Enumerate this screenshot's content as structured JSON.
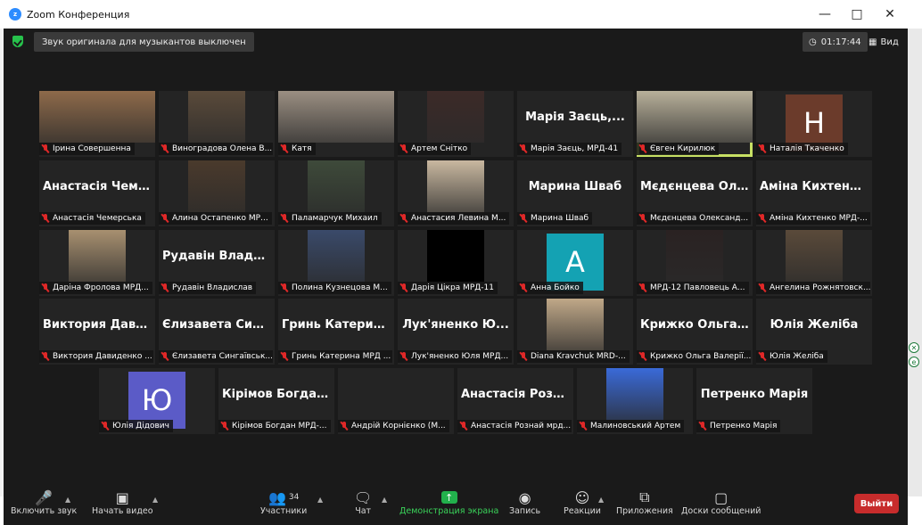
{
  "window": {
    "title": "Zoom Конференция",
    "app_icon": "zoom"
  },
  "top": {
    "notice": "Звук оригинала для музыкантов выключен",
    "timer": "01:17:44",
    "view_label": "Вид"
  },
  "colors": {
    "active_speaker": "#c7e064",
    "muted_mic": "#e02828",
    "leave": "#c72c2c",
    "share": "#22b14c"
  },
  "participants": [
    {
      "label": "Ірина Совершенна",
      "kind": "photo",
      "bg": "#8e6a4a"
    },
    {
      "label": "Виноградова Олена В...",
      "kind": "photo",
      "bg": "#5a4a3a"
    },
    {
      "label": "Катя",
      "kind": "photo",
      "bg": "#9b8f82"
    },
    {
      "label": "Артем Снітко",
      "kind": "photo",
      "bg": "#3c2a28"
    },
    {
      "label": "Марія Заєць, МРД-41",
      "kind": "name",
      "big": "Марія Заєць,..."
    },
    {
      "label": "Євген Кирилюк",
      "kind": "photo",
      "bg": "#b8b09a",
      "active": true
    },
    {
      "label": "Наталія Ткаченко",
      "kind": "avatar",
      "letter": "Н",
      "bg": "#6b3b2b"
    },
    {
      "label": "Анастасія Чемерська",
      "kind": "name",
      "big": "Анастасія Чеме..."
    },
    {
      "label": "Алина Остапенко МР...",
      "kind": "photo",
      "bg": "#4a3a2c"
    },
    {
      "label": "Паламарчук Михаил",
      "kind": "photo",
      "bg": "#3e4a3a"
    },
    {
      "label": "Анастасия Левина М...",
      "kind": "photo",
      "bg": "#c9b8a0"
    },
    {
      "label": "Марина Шваб",
      "kind": "name",
      "big": "Марина Шваб"
    },
    {
      "label": "Мєдєнцева Олександ...",
      "kind": "name",
      "big": "Мєдєнцева Ол..."
    },
    {
      "label": "Аміна Кихтенко МРД-...",
      "kind": "name",
      "big": "Аміна Кихтенк..."
    },
    {
      "label": "Даріна Фролова МРД...",
      "kind": "photo",
      "bg": "#a89070"
    },
    {
      "label": "Рудавін Владислав",
      "kind": "name",
      "big": "Рудавін Владис..."
    },
    {
      "label": "Полина Кузнецова М...",
      "kind": "photo",
      "bg": "#3a4a6a"
    },
    {
      "label": "Дарія Цікра МРД-11",
      "kind": "black"
    },
    {
      "label": "Анна Бойко",
      "kind": "avatar",
      "letter": "А",
      "bg": "#14a2b3"
    },
    {
      "label": "МРД-12 Павловець А...",
      "kind": "photo",
      "bg": "#2a2222"
    },
    {
      "label": "Ангелина Рожнятовск...",
      "kind": "photo",
      "bg": "#5a4a3a"
    },
    {
      "label": "Виктория Давиденко ...",
      "kind": "name",
      "big": "Виктория Дави..."
    },
    {
      "label": "Єлизавета Сингаївськ...",
      "kind": "name",
      "big": "Єлизавета Синг..."
    },
    {
      "label": "Гринь Катерина МРД ...",
      "kind": "name",
      "big": "Гринь Катерин..."
    },
    {
      "label": "Лук'яненко Юля МРД...",
      "kind": "name",
      "big": "Лук'яненко Ю..."
    },
    {
      "label": "Diana Kravchuk MRD-...",
      "kind": "photo",
      "bg": "#c0a888"
    },
    {
      "label": "Крижко Ольга Валерії...",
      "kind": "name",
      "big": "Крижко Ольга..."
    },
    {
      "label": "Юлія Желіба",
      "kind": "name",
      "big": "Юлія Желіба"
    },
    {
      "label": "Юлія Дідович",
      "kind": "avatar",
      "letter": "Ю",
      "bg": "#5b5bc7"
    },
    {
      "label": "Кірімов Богдан МРД-...",
      "kind": "name",
      "big": "Кірімов Богдан..."
    },
    {
      "label": "Андрій Корнієнко (М...",
      "kind": "empty"
    },
    {
      "label": "Анастасія Рознай мрд...",
      "kind": "name",
      "big": "Анастасія Розн..."
    },
    {
      "label": "Малиновський Артем",
      "kind": "photo",
      "bg": "#3a6ad8"
    },
    {
      "label": "Петренко Марія",
      "kind": "name",
      "big": "Петренко Марія"
    }
  ],
  "toolbar": {
    "unmute": "Включить звук",
    "start_video": "Начать видео",
    "participants": "Участники",
    "participants_count": "34",
    "chat": "Чат",
    "share": "Демонстрация экрана",
    "record": "Запись",
    "reactions": "Реакции",
    "apps": "Приложения",
    "whiteboards": "Доски сообщений",
    "leave": "Выйти"
  }
}
